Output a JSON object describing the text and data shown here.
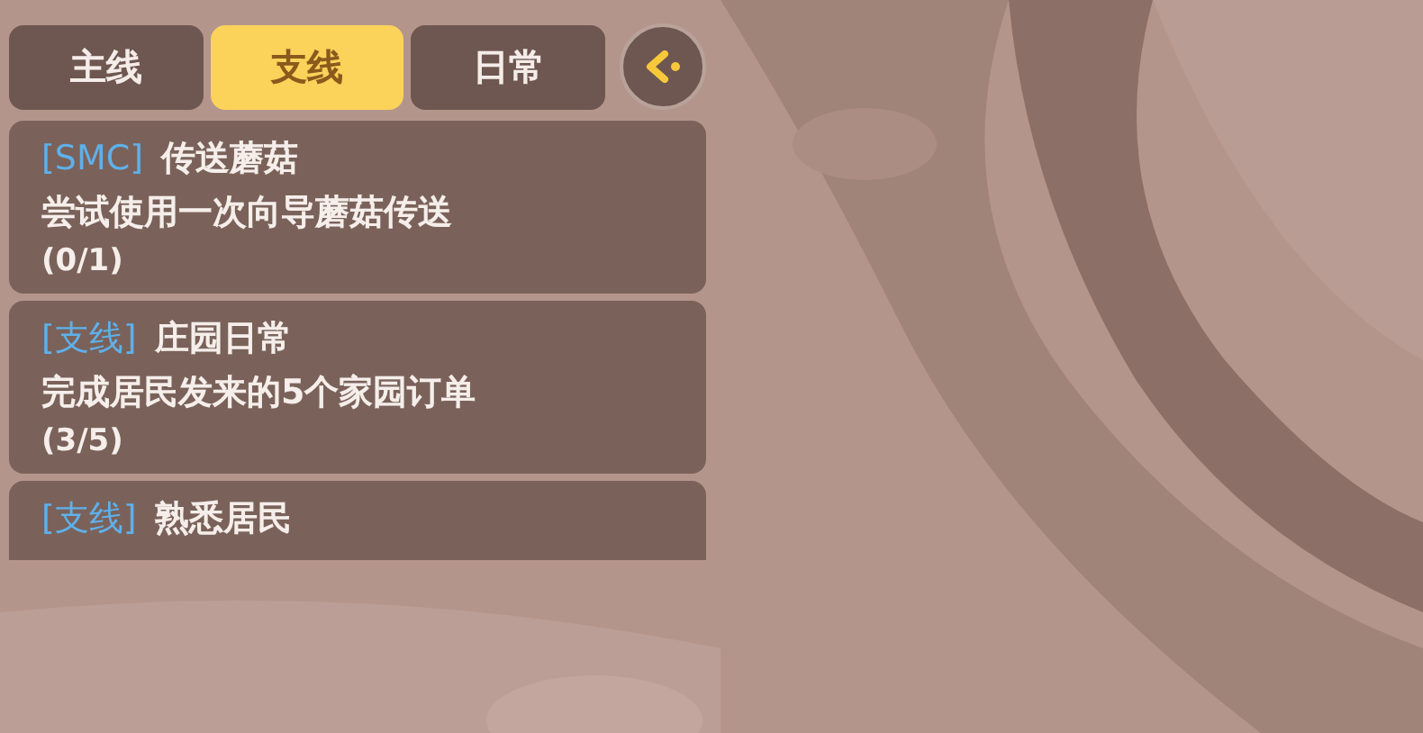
{
  "tabs": [
    {
      "label": "主线",
      "selected": false
    },
    {
      "label": "支线",
      "selected": true
    },
    {
      "label": "日常",
      "selected": false
    }
  ],
  "quests": [
    {
      "tag": "[SMC]",
      "title": "传送蘑菇",
      "description": "尝试使用一次向导蘑菇传送",
      "progress": "(0/1)"
    },
    {
      "tag": "[支线]",
      "title": "庄园日常",
      "description": "完成居民发来的5个家园订单",
      "progress": "(3/5)"
    },
    {
      "tag": "[支线]",
      "title": "熟悉居民"
    }
  ]
}
